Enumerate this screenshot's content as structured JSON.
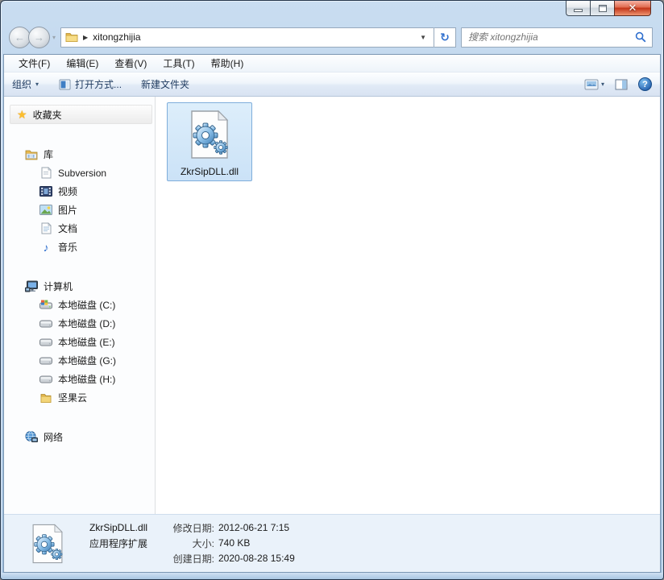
{
  "icons": {
    "close": "✕",
    "back_arrow": "←",
    "forward_arrow": "→",
    "history_caret": "▾",
    "breadcrumb_arrow": "▶",
    "dropdown_solid": "▼",
    "refresh": "↻",
    "caret": "▾",
    "star": "★",
    "music": "♪",
    "help": "?"
  },
  "navbar": {
    "breadcrumb_folder": "xitongzhijia",
    "search_placeholder": "搜索 xitongzhijia"
  },
  "menubar": {
    "items": [
      "文件(F)",
      "编辑(E)",
      "查看(V)",
      "工具(T)",
      "帮助(H)"
    ]
  },
  "toolbar": {
    "organize_label": "组织",
    "open_with_label": "打开方式...",
    "new_folder_label": "新建文件夹"
  },
  "sidebar": {
    "favorites": {
      "label": "收藏夹"
    },
    "libraries": {
      "label": "库",
      "items": [
        {
          "label": "Subversion"
        },
        {
          "label": "视频"
        },
        {
          "label": "图片"
        },
        {
          "label": "文档"
        },
        {
          "label": "音乐"
        }
      ]
    },
    "computer": {
      "label": "计算机",
      "items": [
        {
          "label": "本地磁盘 (C:)"
        },
        {
          "label": "本地磁盘 (D:)"
        },
        {
          "label": "本地磁盘 (E:)"
        },
        {
          "label": "本地磁盘 (G:)"
        },
        {
          "label": "本地磁盘 (H:)"
        },
        {
          "label": "坚果云"
        }
      ]
    },
    "network": {
      "label": "网络"
    }
  },
  "main": {
    "file_label": "ZkrSipDLL.dll"
  },
  "details": {
    "file_name": "ZkrSipDLL.dll",
    "file_type": "应用程序扩展",
    "modified_label": "修改日期:",
    "modified_value": "2012-06-21 7:15",
    "size_label": "大小:",
    "size_value": "740 KB",
    "created_label": "创建日期:",
    "created_value": "2020-08-28 15:49"
  }
}
